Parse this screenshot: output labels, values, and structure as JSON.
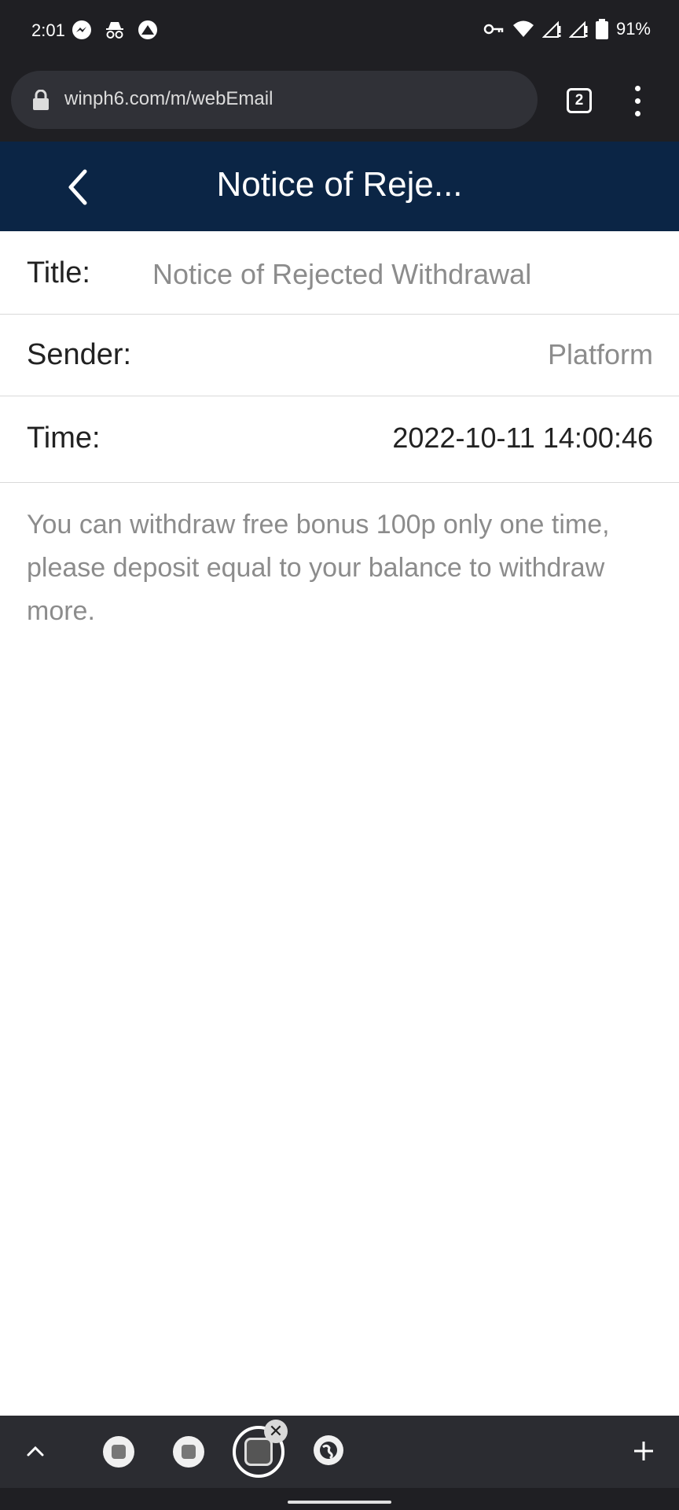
{
  "status_bar": {
    "time": "2:01",
    "battery": "91%",
    "left_icons": [
      "messenger-icon",
      "incognito-icon",
      "vpn-shield-icon"
    ],
    "right_icons": [
      "key-icon",
      "wifi-icon",
      "signal-icon",
      "signal-icon",
      "battery-icon"
    ]
  },
  "browser": {
    "url": "winph6.com/m/webEmail",
    "tab_count": "2"
  },
  "header": {
    "title": "Notice of Reje..."
  },
  "details": {
    "title_label": "Title:",
    "title_value": "Notice of Rejected Withdrawal",
    "sender_label": "Sender:",
    "sender_value": "Platform",
    "time_label": "Time:",
    "time_value": "2022-10-11 14:00:46"
  },
  "message": {
    "body": "You can withdraw free bonus 100p only one time, please deposit equal to your balance to withdraw more."
  },
  "tab_strip": {
    "close_glyph": "✕"
  },
  "colors": {
    "header_bg": "#0b2545",
    "chrome_bg": "#1f1f23",
    "muted_text": "#8c8c8c"
  }
}
